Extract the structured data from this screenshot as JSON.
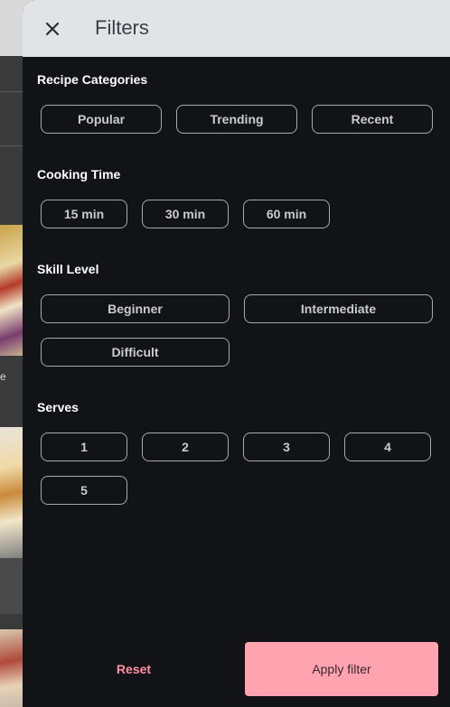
{
  "header": {
    "title": "Filters",
    "close_icon": "close-icon"
  },
  "background": {
    "caption_fragment": "e"
  },
  "sections": {
    "categories": {
      "title": "Recipe Categories",
      "options": [
        "Popular",
        "Trending",
        "Recent"
      ]
    },
    "cooking_time": {
      "title": "Cooking Time",
      "options": [
        "15 min",
        "30 min",
        "60 min"
      ]
    },
    "skill_level": {
      "title": "Skill Level",
      "options": [
        "Beginner",
        "Intermediate",
        "Difficult"
      ]
    },
    "serves": {
      "title": "Serves",
      "options": [
        "1",
        "2",
        "3",
        "4",
        "5"
      ]
    }
  },
  "footer": {
    "reset_label": "Reset",
    "apply_label": "Apply filter"
  },
  "colors": {
    "drawer_bg": "#121316",
    "header_bg": "#e2e3e6",
    "accent": "#ffa3b0",
    "reset_text": "#ff8fa3",
    "chip_border": "#a7a9ad"
  }
}
